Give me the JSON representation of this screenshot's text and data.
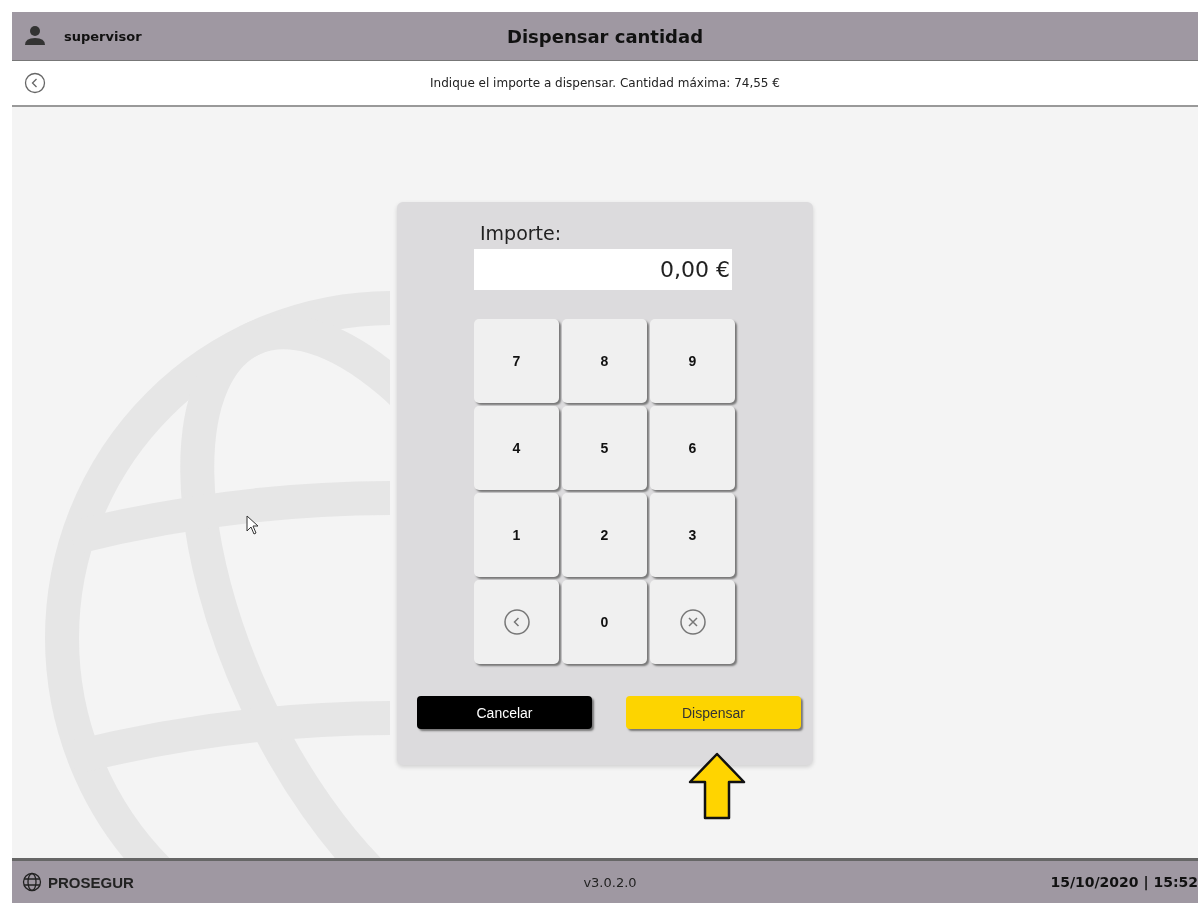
{
  "header": {
    "user": "supervisor",
    "title": "Dispensar cantidad"
  },
  "instruction": "Indique el importe a dispensar. Cantidad máxima: 74,55 €",
  "dialog": {
    "label": "Importe:",
    "value": "0,00 €",
    "keypad": [
      {
        "kind": "digit",
        "label": "7"
      },
      {
        "kind": "digit",
        "label": "8"
      },
      {
        "kind": "digit",
        "label": "9"
      },
      {
        "kind": "digit",
        "label": "4"
      },
      {
        "kind": "digit",
        "label": "5"
      },
      {
        "kind": "digit",
        "label": "6"
      },
      {
        "kind": "digit",
        "label": "1"
      },
      {
        "kind": "digit",
        "label": "2"
      },
      {
        "kind": "digit",
        "label": "3"
      },
      {
        "kind": "back"
      },
      {
        "kind": "digit",
        "label": "0"
      },
      {
        "kind": "clear"
      }
    ],
    "buttons": [
      {
        "kind": "cancel",
        "label": "Cancelar"
      },
      {
        "kind": "confirm",
        "label": "Dispensar"
      }
    ]
  },
  "footer": {
    "brand": "PROSEGUR",
    "version": "v3.0.2.0",
    "datetime": "15/10/2020 | 15:52"
  }
}
